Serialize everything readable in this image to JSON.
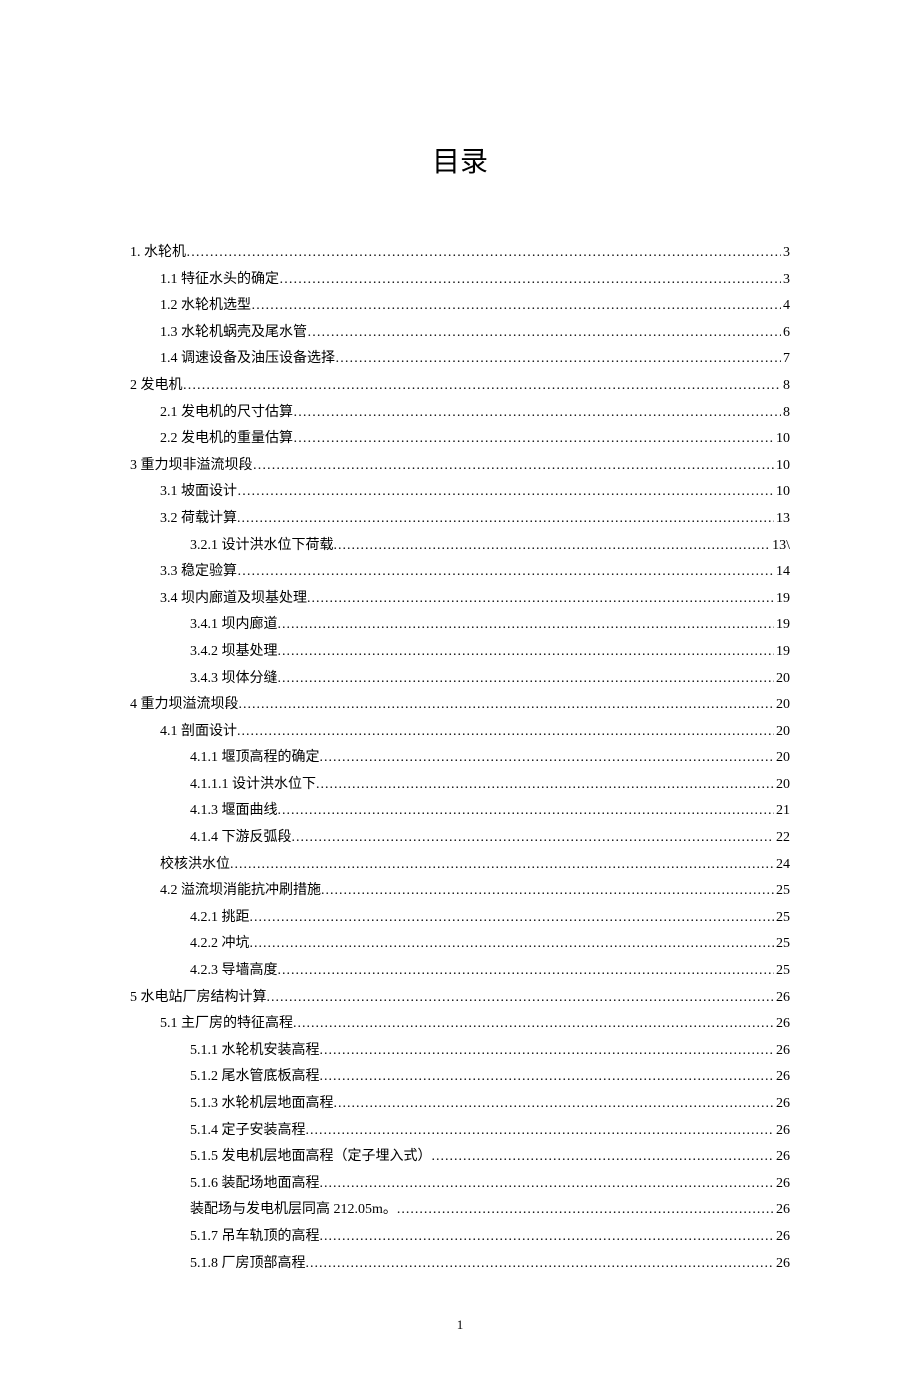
{
  "title": "目录",
  "page_number": "1",
  "toc": [
    {
      "indent": 0,
      "label": "1.  水轮机",
      "page": "3",
      "leader": "dots"
    },
    {
      "indent": 1,
      "label": "1.1 特征水头的确定",
      "page": "3",
      "leader": "dots"
    },
    {
      "indent": 1,
      "label": "1.2 水轮机选型",
      "page": "4",
      "leader": "dots"
    },
    {
      "indent": 1,
      "label": "1.3 水轮机蜗壳及尾水管",
      "page": "6",
      "leader": "dots"
    },
    {
      "indent": 1,
      "label": "1.4 调速设备及油压设备选择",
      "page": "7",
      "leader": "dots"
    },
    {
      "indent": 0,
      "label": "2 发电机",
      "page": "8",
      "leader": "dots"
    },
    {
      "indent": 1,
      "label": "2.1 发电机的尺寸估算",
      "page": "8",
      "leader": "dots"
    },
    {
      "indent": 1,
      "label": "2.2 发电机的重量估算",
      "page": "10",
      "leader": "dots"
    },
    {
      "indent": 0,
      "label": "3  重力坝非溢流坝段",
      "page": "10",
      "leader": "dots"
    },
    {
      "indent": 1,
      "label": "3.1 坡面设计",
      "page": "10",
      "leader": "dots"
    },
    {
      "indent": 1,
      "label": "3.2 荷载计算",
      "page": "13",
      "leader": "periods"
    },
    {
      "indent": 2,
      "label": "3.2.1 设计洪水位下荷载",
      "page": "13\\",
      "leader": "periods"
    },
    {
      "indent": 1,
      "label": "3.3 稳定验算",
      "page": "14",
      "leader": "dots"
    },
    {
      "indent": 1,
      "label": "3.4 坝内廊道及坝基处理",
      "page": "19",
      "leader": "periods"
    },
    {
      "indent": 2,
      "label": "3.4.1 坝内廊道",
      "page": "19",
      "leader": "periods"
    },
    {
      "indent": 2,
      "label": "3.4.2 坝基处理",
      "page": "19",
      "leader": "periods"
    },
    {
      "indent": 2,
      "label": "3.4.3  坝体分缝",
      "page": "20",
      "leader": "periods"
    },
    {
      "indent": 0,
      "label": "4 重力坝溢流坝段",
      "page": "20",
      "leader": "periods"
    },
    {
      "indent": 1,
      "label": "4.1 剖面设计",
      "page": "20",
      "leader": "periods"
    },
    {
      "indent": 2,
      "label": "4.1.1  堰顶高程的确定",
      "page": "20",
      "leader": "periods"
    },
    {
      "indent": 2,
      "label": "4.1.1.1 设计洪水位下",
      "page": "20",
      "leader": "periods"
    },
    {
      "indent": 2,
      "label": "4.1.3  堰面曲线",
      "page": "21",
      "leader": "periods"
    },
    {
      "indent": 2,
      "label": "4.1.4  下游反弧段",
      "page": "22",
      "leader": "periods"
    },
    {
      "indent": 1,
      "label": "校核洪水位",
      "page": "24",
      "leader": "periods"
    },
    {
      "indent": 1,
      "label": "4.2 溢流坝消能抗冲刷措施",
      "page": "25",
      "leader": "periods"
    },
    {
      "indent": 2,
      "label": "4.2.1 挑距",
      "page": "25",
      "leader": "periods"
    },
    {
      "indent": 2,
      "label": "4.2.2 冲坑",
      "page": "25",
      "leader": "periods"
    },
    {
      "indent": 2,
      "label": "4.2.3 导墙高度",
      "page": "25",
      "leader": "periods"
    },
    {
      "indent": 0,
      "label": "5 水电站厂房结构计算",
      "page": "26",
      "leader": "periods"
    },
    {
      "indent": 1,
      "label": "5.1   主厂房的特征高程",
      "page": "26",
      "leader": "periods"
    },
    {
      "indent": 2,
      "label": "5.1.1 水轮机安装高程",
      "page": "26",
      "leader": "periods"
    },
    {
      "indent": 2,
      "label": "5.1.2 尾水管底板高程",
      "page": "26",
      "leader": "periods"
    },
    {
      "indent": 2,
      "label": "5.1.3 水轮机层地面高程",
      "page": "26",
      "leader": "periods"
    },
    {
      "indent": 2,
      "label": "5.1.4 定子安装高程",
      "page": "26",
      "leader": "periods"
    },
    {
      "indent": 2,
      "label": "5.1.5 发电机层地面高程（定子埋入式）",
      "page": "26",
      "leader": "periods"
    },
    {
      "indent": 2,
      "label": "5.1.6 装配场地面高程",
      "page": "26",
      "leader": "periods"
    },
    {
      "indent": 2,
      "label": "装配场与发电机层同高 212.05m。",
      "page": "26",
      "leader": "periods"
    },
    {
      "indent": 2,
      "label": "5.1.7 吊车轨顶的高程",
      "page": "26",
      "leader": "periods"
    },
    {
      "indent": 2,
      "label": "5.1.8 厂房顶部高程",
      "page": "26",
      "leader": "periods"
    }
  ]
}
